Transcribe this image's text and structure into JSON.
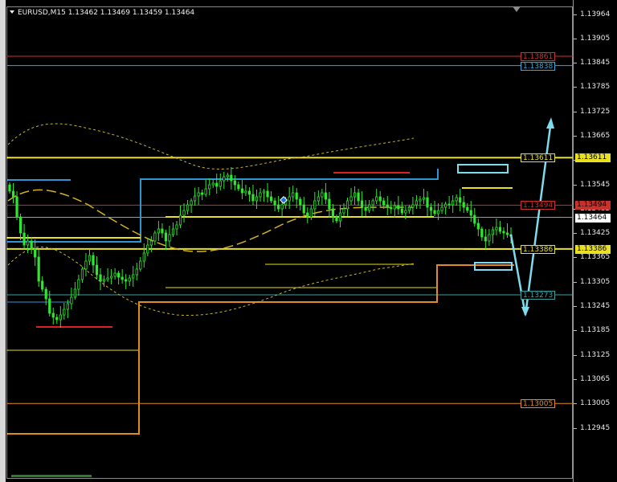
{
  "window": {
    "header": "EURUSD,M15  1.13462 1.13469 1.13459 1.13464",
    "symbol": "EURUSD",
    "timeframe": "M15",
    "ohlc": {
      "open": "1.13462",
      "high": "1.13469",
      "low": "1.13459",
      "close": "1.13464"
    }
  },
  "price_axis": {
    "ticks": [
      "1.13964",
      "1.13905",
      "1.13845",
      "1.13785",
      "1.13725",
      "1.13665",
      "1.13605",
      "1.13545",
      "1.13485",
      "1.13425",
      "1.13365",
      "1.13305",
      "1.13245",
      "1.13185",
      "1.13125",
      "1.13065",
      "1.13005",
      "1.12945"
    ],
    "current_price": "1.13464"
  },
  "levels": [
    {
      "id": "red-resistance",
      "price": 1.13861,
      "label": "1.13861",
      "color": "#c8322c"
    },
    {
      "id": "blue-resistance",
      "price": 1.13838,
      "label": "1.13838",
      "color": "#32a8dc"
    },
    {
      "id": "yellow-upper",
      "price": 1.13611,
      "label": "1.13611",
      "color": "#e8e020"
    },
    {
      "id": "red-mid",
      "price": 1.13494,
      "label": "1.13494",
      "color": "#c8322c"
    },
    {
      "id": "yellow-lower",
      "price": 1.13386,
      "label": "1.13386",
      "color": "#e8e020"
    },
    {
      "id": "teal-support",
      "price": 1.13273,
      "label": "1.13273",
      "color": "#3ca0a0"
    },
    {
      "id": "orange-support",
      "price": 1.13005,
      "label": "1.13005",
      "color": "#e08a20"
    }
  ],
  "colors": {
    "background": "#000000",
    "candle": "#2ee82e",
    "forecast_arrow": "#7fdcec",
    "band": "#c8b81e",
    "ma": "#d2b21e",
    "current_line": "#ffffff"
  }
}
